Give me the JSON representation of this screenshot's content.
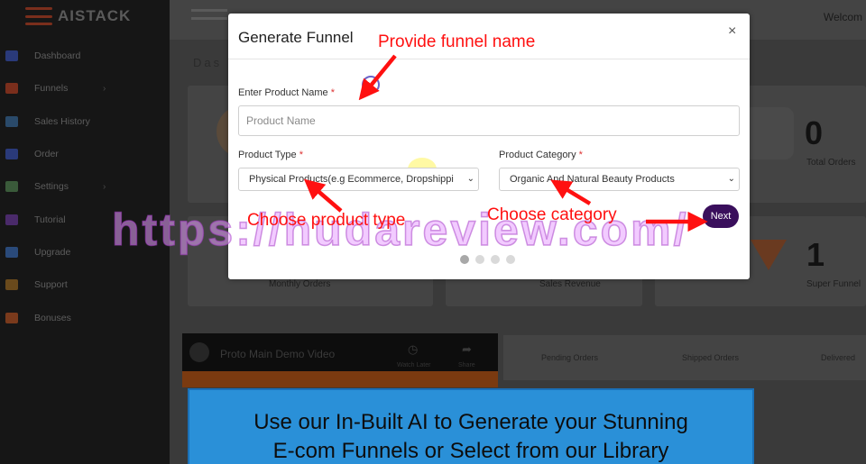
{
  "app": {
    "logo": "AISTACK",
    "welcome": "Welcom"
  },
  "sidebar": {
    "items": [
      {
        "label": "Dashboard",
        "icon": "dashboard-icon",
        "color": "#2a3a7a",
        "chevron": false
      },
      {
        "label": "Funnels",
        "icon": "funnel-icon",
        "color": "#7a2e1c",
        "chevron": true
      },
      {
        "label": "Sales History",
        "icon": "history-icon",
        "color": "#2a4a6a",
        "chevron": false
      },
      {
        "label": "Order",
        "icon": "order-icon",
        "color": "#2a3a7a",
        "chevron": false
      },
      {
        "label": "Settings",
        "icon": "gear-icon",
        "color": "#3a5a3a",
        "chevron": true
      },
      {
        "label": "Tutorial",
        "icon": "tutorial-icon",
        "color": "#4a2a6a",
        "chevron": false
      },
      {
        "label": "Upgrade",
        "icon": "upgrade-icon",
        "color": "#2a4a7a",
        "chevron": false
      },
      {
        "label": "Support",
        "icon": "support-icon",
        "color": "#6a4a1c",
        "chevron": false
      },
      {
        "label": "Bonuses",
        "icon": "gift-icon",
        "color": "#7a3a1c",
        "chevron": false
      }
    ],
    "chevron_glyph": "›"
  },
  "dashboard": {
    "title": "Das",
    "cards": [
      {
        "value": "0",
        "label": "Total Orders"
      },
      {
        "value": "1",
        "label": "Super Funnel"
      }
    ],
    "card_labels_lower": [
      "Monthly Orders",
      "Sales Revenue"
    ],
    "video": {
      "title": "Proto Main Demo Video",
      "watch_later": "Watch Later",
      "share": "Share"
    },
    "table_headers": [
      "Pending Orders",
      "Shipped Orders",
      "Delivered"
    ]
  },
  "modal": {
    "title": "Generate Funnel",
    "close_glyph": "×",
    "product_name": {
      "label": "Enter Product Name",
      "required": "*",
      "placeholder": "Product Name",
      "value": ""
    },
    "product_type": {
      "label": "Product Type",
      "required": "*",
      "selected": "Physical Products(e.g Ecommerce, Dropshippi"
    },
    "product_category": {
      "label": "Product Category",
      "required": "*",
      "selected": "Organic And Natural Beauty Products"
    },
    "next_label": "Next",
    "step_dots": {
      "total": 4,
      "active": 1
    },
    "select_chevron": "⌄"
  },
  "annotations": {
    "funnel_name": "Provide funnel name",
    "product_type": "Choose product type",
    "category": "Choose category",
    "color": "#ff1010"
  },
  "watermark": "https://hudareview.com/",
  "banner": {
    "line1": "Use our In-Built AI to Generate your Stunning",
    "line2": "E-com Funnels or Select from our Library"
  }
}
